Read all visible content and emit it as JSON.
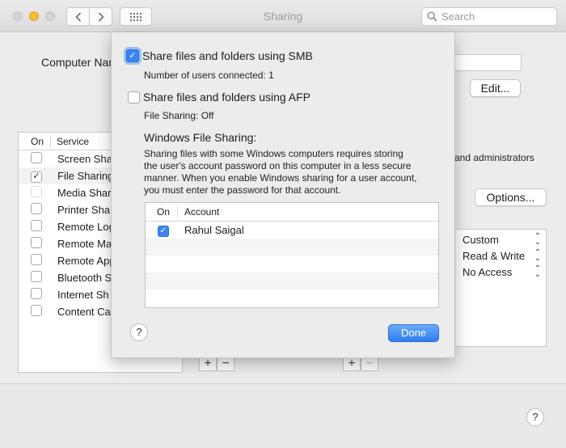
{
  "window": {
    "title": "Sharing"
  },
  "search": {
    "placeholder": "Search"
  },
  "background": {
    "computer_name_label": "Computer Nan",
    "edit_label": "Edit...",
    "services": {
      "header_on": "On",
      "header_service": "Service",
      "items": [
        {
          "label": "Screen Sha",
          "checked": false
        },
        {
          "label": "File Sharing",
          "checked": true
        },
        {
          "label": "Media Shar",
          "checked": false
        },
        {
          "label": "Printer Sha",
          "checked": false
        },
        {
          "label": "Remote Log",
          "checked": false
        },
        {
          "label": "Remote Ma",
          "checked": false
        },
        {
          "label": "Remote App",
          "checked": false
        },
        {
          "label": "Bluetooth S",
          "checked": false
        },
        {
          "label": "Internet Sh",
          "checked": false
        },
        {
          "label": "Content Ca",
          "checked": false
        }
      ]
    },
    "admins_text": "and administrators",
    "options_label": "Options...",
    "permissions": [
      "Custom",
      "Read & Write",
      "No Access"
    ],
    "add_symbol": "+",
    "remove_symbol": "−",
    "help_symbol": "?"
  },
  "sheet": {
    "smb_label": "Share files and folders using SMB",
    "smb_checked": true,
    "users_connected": "Number of users connected: 1",
    "afp_label": "Share files and folders using AFP",
    "afp_checked": false,
    "afp_status": "File Sharing: Off",
    "windows_heading": "Windows File Sharing:",
    "windows_desc": [
      "Sharing files with some Windows computers requires storing",
      "the user's account password on this computer in a less secure",
      "manner. When you enable Windows sharing for a user account,",
      "you must enter the password for that account."
    ],
    "accounts": {
      "header_on": "On",
      "header_account": "Account",
      "rows": [
        {
          "name": "Rahul Saigal",
          "checked": true
        }
      ]
    },
    "help_symbol": "?",
    "done_label": "Done"
  },
  "colors": {
    "accent": "#3b84f0",
    "done_button": "#2f7ef0",
    "traffic_yellow": "#f6bd2f"
  }
}
